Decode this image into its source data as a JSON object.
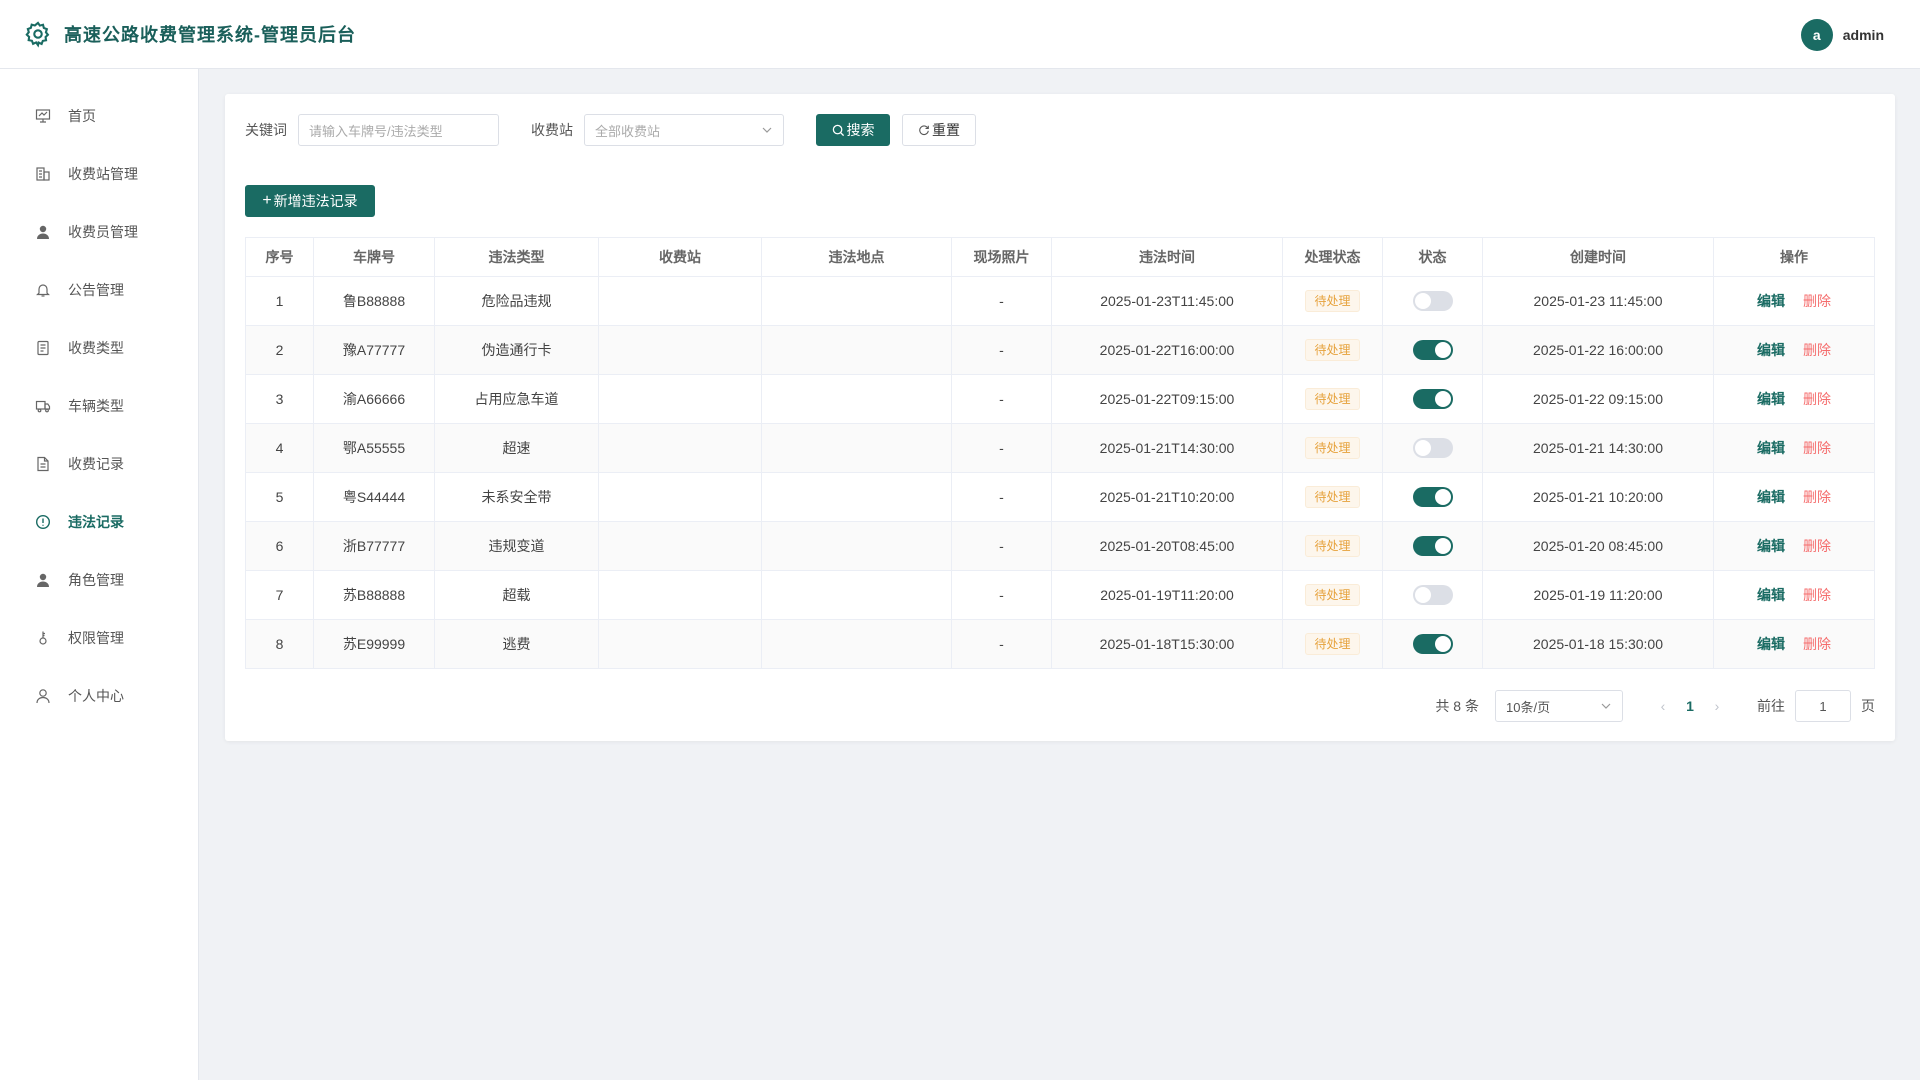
{
  "header": {
    "title": "高速公路收费管理系统-管理员后台",
    "avatar_letter": "a",
    "username": "admin"
  },
  "sidebar": {
    "items": [
      {
        "label": "首页",
        "icon": "dashboard-icon"
      },
      {
        "label": "收费站管理",
        "icon": "building-icon"
      },
      {
        "label": "收费员管理",
        "icon": "user-icon"
      },
      {
        "label": "公告管理",
        "icon": "bell-icon"
      },
      {
        "label": "收费类型",
        "icon": "document-icon"
      },
      {
        "label": "车辆类型",
        "icon": "truck-icon"
      },
      {
        "label": "收费记录",
        "icon": "file-icon"
      },
      {
        "label": "违法记录",
        "icon": "warning-circle-icon",
        "active": true
      },
      {
        "label": "角色管理",
        "icon": "user-icon"
      },
      {
        "label": "权限管理",
        "icon": "key-icon"
      },
      {
        "label": "个人中心",
        "icon": "person-outline-icon"
      }
    ]
  },
  "filter": {
    "keyword_label": "关键词",
    "keyword_placeholder": "请输入车牌号/违法类型",
    "station_label": "收费站",
    "station_value": "全部收费站",
    "search_label": "搜索",
    "reset_label": "重置"
  },
  "add_label": "新增违法记录",
  "table": {
    "headers": [
      "序号",
      "车牌号",
      "违法类型",
      "收费站",
      "违法地点",
      "现场照片",
      "违法时间",
      "处理状态",
      "状态",
      "创建时间",
      "操作"
    ],
    "edit_label": "编辑",
    "delete_label": "删除",
    "rows": [
      {
        "no": "1",
        "plate": "鲁B88888",
        "type": "危险品违规",
        "station": "",
        "location": "",
        "photo": "-",
        "time": "2025-01-23T11:45:00",
        "process": "待处理",
        "enabled": false,
        "created": "2025-01-23 11:45:00"
      },
      {
        "no": "2",
        "plate": "豫A77777",
        "type": "伪造通行卡",
        "station": "",
        "location": "",
        "photo": "-",
        "time": "2025-01-22T16:00:00",
        "process": "待处理",
        "enabled": true,
        "created": "2025-01-22 16:00:00"
      },
      {
        "no": "3",
        "plate": "渝A66666",
        "type": "占用应急车道",
        "station": "",
        "location": "",
        "photo": "-",
        "time": "2025-01-22T09:15:00",
        "process": "待处理",
        "enabled": true,
        "created": "2025-01-22 09:15:00"
      },
      {
        "no": "4",
        "plate": "鄂A55555",
        "type": "超速",
        "station": "",
        "location": "",
        "photo": "-",
        "time": "2025-01-21T14:30:00",
        "process": "待处理",
        "enabled": false,
        "created": "2025-01-21 14:30:00"
      },
      {
        "no": "5",
        "plate": "粤S44444",
        "type": "未系安全带",
        "station": "",
        "location": "",
        "photo": "-",
        "time": "2025-01-21T10:20:00",
        "process": "待处理",
        "enabled": true,
        "created": "2025-01-21 10:20:00"
      },
      {
        "no": "6",
        "plate": "浙B77777",
        "type": "违规变道",
        "station": "",
        "location": "",
        "photo": "-",
        "time": "2025-01-20T08:45:00",
        "process": "待处理",
        "enabled": true,
        "created": "2025-01-20 08:45:00"
      },
      {
        "no": "7",
        "plate": "苏B88888",
        "type": "超载",
        "station": "",
        "location": "",
        "photo": "-",
        "time": "2025-01-19T11:20:00",
        "process": "待处理",
        "enabled": false,
        "created": "2025-01-19 11:20:00"
      },
      {
        "no": "8",
        "plate": "苏E99999",
        "type": "逃费",
        "station": "",
        "location": "",
        "photo": "-",
        "time": "2025-01-18T15:30:00",
        "process": "待处理",
        "enabled": true,
        "created": "2025-01-18 15:30:00"
      }
    ]
  },
  "pager": {
    "total_text": "共 8 条",
    "page_size": "10条/页",
    "current_page": "1",
    "goto_label": "前往",
    "goto_value": "1",
    "page_suffix": "页"
  },
  "colors": {
    "brand": "#1a6b63",
    "danger": "#f56c6c",
    "warning": "#e6a23c"
  }
}
